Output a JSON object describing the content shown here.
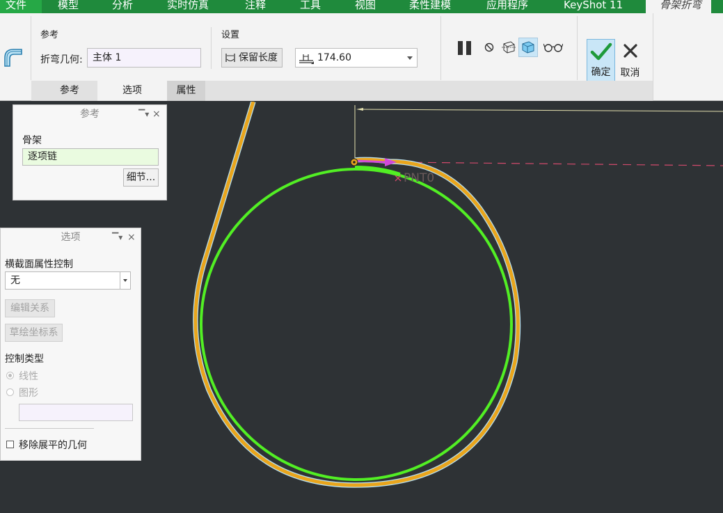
{
  "menubar": {
    "items": [
      "文件",
      "模型",
      "分析",
      "实时仿真",
      "注释",
      "工具",
      "视图",
      "柔性建模",
      "应用程序",
      "KeyShot 11"
    ],
    "active_tab": "骨架折弯"
  },
  "ribbon": {
    "reference_group": {
      "title": "参考",
      "bend_geometry_label": "折弯几何:",
      "bend_geometry_value": "主体 1"
    },
    "settings_group": {
      "title": "设置",
      "keep_length_label": "保留长度",
      "length_value": "174.60"
    },
    "tabs": [
      "参考",
      "选项",
      "属性"
    ],
    "ok_label": "确定",
    "cancel_label": "取消"
  },
  "reference_panel": {
    "title": "参考",
    "skeleton_label": "骨架",
    "skeleton_value": "逐项链",
    "details_button": "细节..."
  },
  "options_panel": {
    "title": "选项",
    "section_control_label": "横截面属性控制",
    "section_control_value": "无",
    "edit_relations_button": "编辑关系",
    "sketch_csys_button": "草绘坐标系",
    "control_type_label": "控制类型",
    "control_type_options": [
      "线性",
      "图形"
    ],
    "remove_flat_label": "移除展平的几何"
  },
  "viewport": {
    "point_label": "PNT0",
    "colors": {
      "background": "#2e3235",
      "bent_body": "#e9a51c",
      "skeleton": "#52ef24",
      "arrow": "#d24ad8",
      "datum": "#d24a6c",
      "dimension_line": "#e6e2b0"
    }
  }
}
